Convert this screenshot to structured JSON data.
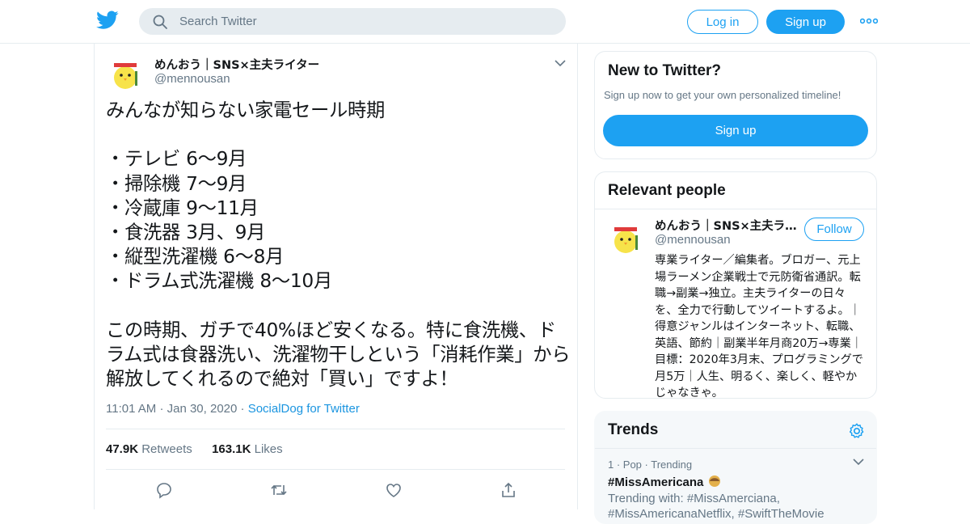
{
  "colors": {
    "brand": "#1da1f2",
    "link": "#1b95e0",
    "muted": "#657786",
    "text": "#14171a",
    "border": "#e6ecf0"
  },
  "header": {
    "logo_icon": "twitter-bird-icon",
    "search_placeholder": "Search Twitter",
    "login_label": "Log in",
    "signup_label": "Sign up",
    "more_icon": "more-dots-icon"
  },
  "tweet": {
    "author_name": "めんおう｜SNS×主夫ライター",
    "author_handle": "@mennousan",
    "text": "みんなが知らない家電セール時期\n\n・テレビ 6～9月\n・掃除機 7～9月\n・冷蔵庫 9～11月\n・食洗器 3月、9月\n・縦型洗濯機 6～8月\n・ドラム式洗濯機 8～10月\n\nこの時期、ガチで40%ほど安くなる。特に食洗機、ドラム式は食器洗い、洗濯物干しという「消耗作業」から解放してくれるので絶対「買い」ですよ！",
    "time": "11:01 AM",
    "date": "Jan 30, 2020",
    "source": "SocialDog for Twitter",
    "retweets_count": "47.9K",
    "retweets_label": "Retweets",
    "likes_count": "163.1K",
    "likes_label": "Likes",
    "action_icons": [
      "reply-icon",
      "retweet-icon",
      "like-icon",
      "share-icon"
    ]
  },
  "new_to_twitter": {
    "title": "New to Twitter?",
    "subtitle": "Sign up now to get your own personalized timeline!",
    "signup_label": "Sign up"
  },
  "relevant_people": {
    "title": "Relevant people",
    "name": "めんおう｜SNS×主夫ライター",
    "handle": "@mennousan",
    "follow_label": "Follow",
    "bio": "専業ライター／編集者。ブロガー、元上場ラーメン企業戦士で元防衛省通訳。転職→副業→独立。主夫ライターの日々を、全力で行動してツイートするよ。｜得意ジャンルはインターネット、転職、英語、節約｜副業半年月商20万→専業｜目標：2020年3月末、プログラミングで月5万｜人生、明るく、楽しく、軽やかじゃなきゃ。"
  },
  "trends": {
    "title": "Trends",
    "settings_icon": "gear-icon",
    "items": [
      {
        "rank_meta": "1 · Pop · Trending",
        "tag": "#MissAmericana",
        "trending_with": "Trending with: #MissAmerciana,",
        "trending_with_2": "#MissAmericanaNetflix, #SwiftTheMovie"
      }
    ]
  }
}
